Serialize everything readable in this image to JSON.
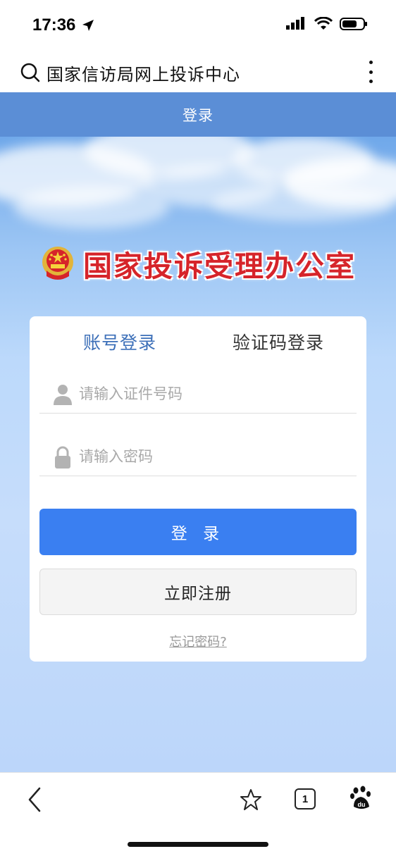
{
  "status_bar": {
    "time": "17:36"
  },
  "browser": {
    "title": "国家信访局网上投诉中心"
  },
  "header": {
    "title": "登录"
  },
  "agency": {
    "title": "国家投诉受理办公室"
  },
  "login": {
    "tabs": [
      {
        "label": "账号登录",
        "active": true
      },
      {
        "label": "验证码登录",
        "active": false
      }
    ],
    "id_placeholder": "请输入证件号码",
    "password_placeholder": "请输入密码",
    "login_button": "登 录",
    "register_button": "立即注册",
    "forgot_link": "忘记密码?"
  },
  "toolbar": {
    "tab_count": "1"
  },
  "colors": {
    "header_bg": "#5b8ed6",
    "accent": "#3a7ff1",
    "agency_title": "#d6242a",
    "active_tab": "#3c6fb8"
  },
  "icons": {
    "status": [
      "location-arrow-icon",
      "signal-icon",
      "wifi-icon",
      "battery-icon"
    ],
    "browser": [
      "search-icon",
      "more-vertical-icon"
    ],
    "fields": [
      "user-icon",
      "lock-icon"
    ],
    "toolbar": [
      "back-icon",
      "star-icon",
      "tabs-icon",
      "baidu-paw-icon"
    ]
  }
}
